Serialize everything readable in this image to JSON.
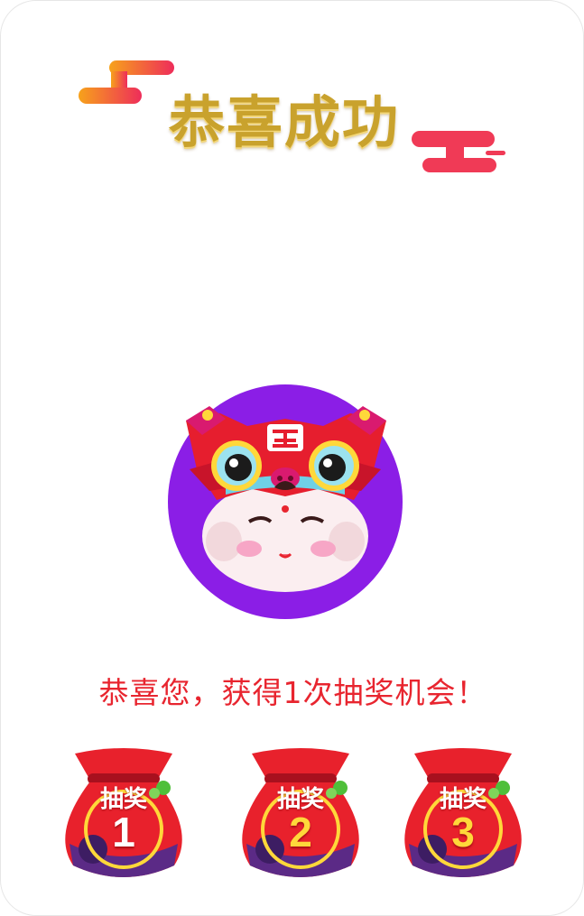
{
  "title": "恭喜成功",
  "message": "恭喜您，获得1次抽奖机会！",
  "avatar_icon": "lion-dance-mascot",
  "bags": [
    {
      "label": "抽奖",
      "number": "1",
      "number_color": "#ffffff"
    },
    {
      "label": "抽奖",
      "number": "2",
      "number_color": "#ffd83a"
    },
    {
      "label": "抽奖",
      "number": "3",
      "number_color": "#ffd83a"
    }
  ],
  "colors": {
    "title_gold": "#c9a22d",
    "message_red": "#e8252f",
    "avatar_purple": "#8b1ee6",
    "bag_red": "#e8212c",
    "cloud_gradient_start": "#f7a21b",
    "cloud_gradient_end": "#ee2d5a"
  }
}
